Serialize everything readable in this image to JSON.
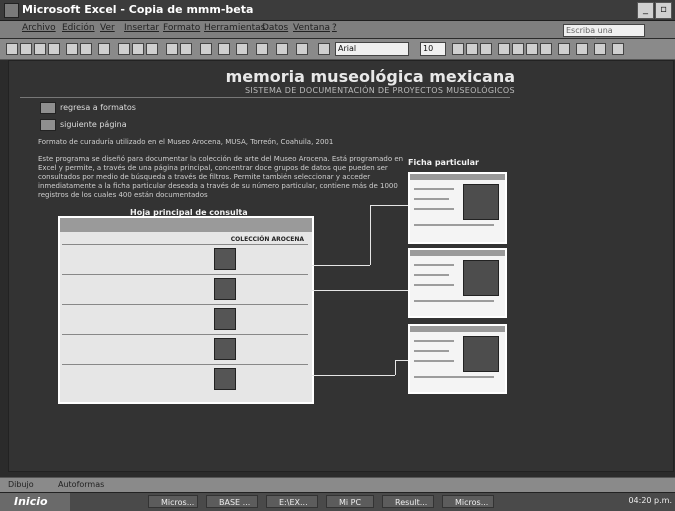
{
  "window": {
    "title": "Microsoft Excel - Copia de mmm-beta"
  },
  "menu": {
    "items": [
      "Archivo",
      "Edición",
      "Ver",
      "Insertar",
      "Formato",
      "Herramientas",
      "Datos",
      "Ventana",
      "?"
    ],
    "ask_placeholder": "Escriba una pregunta"
  },
  "toolbar": {
    "font": "Arial",
    "size": "10"
  },
  "page": {
    "brand": "memoria museológica mexicana",
    "subtitle": "SISTEMA DE DOCUMENTACIÓN DE PROYECTOS MUSEOLÓGICOS",
    "nav": {
      "back": "regresa a formatos",
      "next": "siguiente página"
    },
    "intro": "Formato de curaduría utilizado en el Museo Arocena, MUSA, Torreón, Coahuila, 2001",
    "description": "Este programa se diseñó para documentar la colección de arte del Museo Arocena. Está programado en Excel y permite, a través de una página principal, concentrar doce grupos de datos que pueden ser consultados por medio de búsqueda a través de filtros. Permite también seleccionar y acceder inmediatamente a la ficha particular deseada a través de su número particular, contiene más de 1000 registros de los cuales 400 están documentados",
    "main_label": "Hoja principal de consulta",
    "collection_banner": "COLECCIÓN AROCENA",
    "card_label": "Ficha particular"
  },
  "drawing": {
    "draw": "Dibujo",
    "autoshapes": "Autoformas"
  },
  "taskbar": {
    "start": "Inicio",
    "tasks": [
      "Micros...",
      "BASE ...",
      "E:\\EX...",
      "Mi PC",
      "Result...",
      "Micros..."
    ],
    "clock": "04:20 p.m."
  }
}
